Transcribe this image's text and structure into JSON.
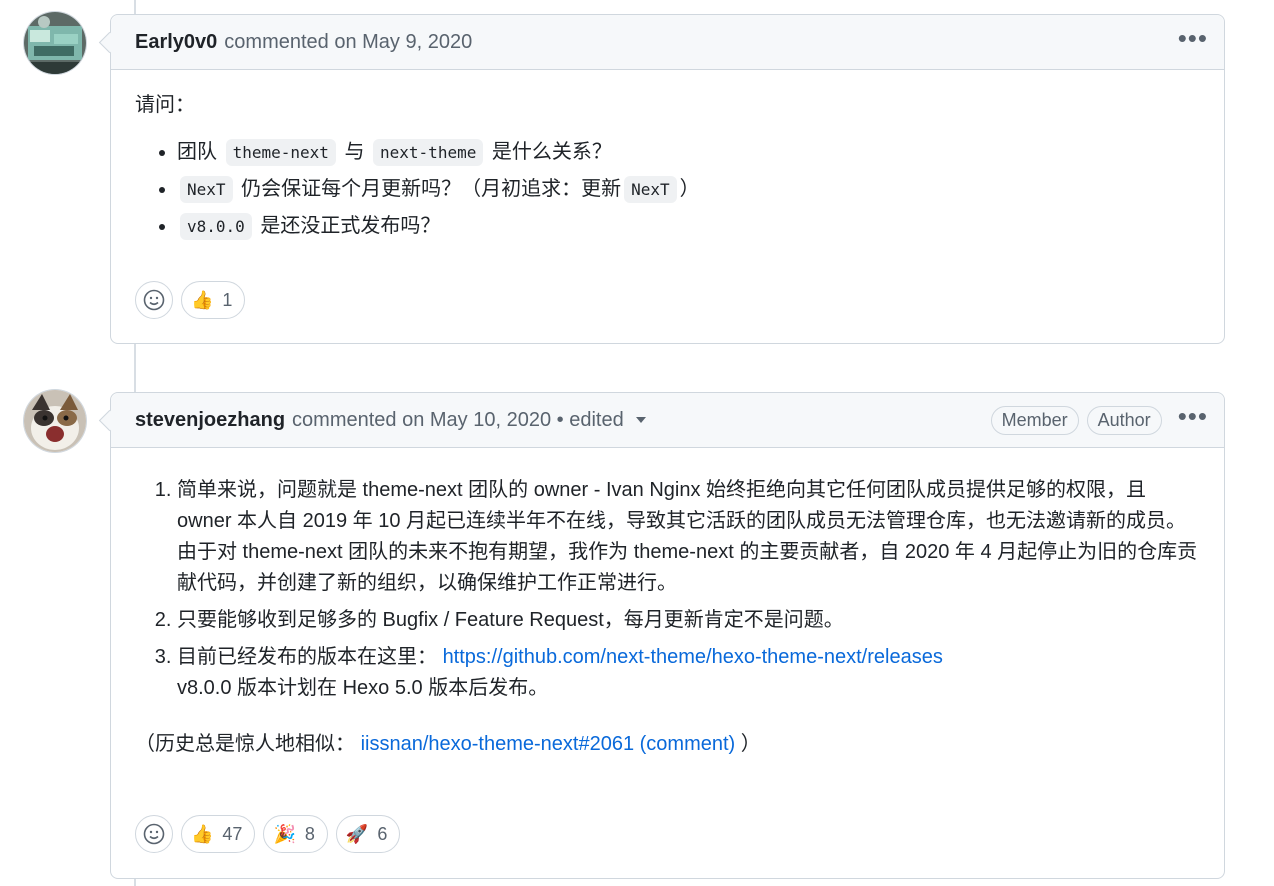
{
  "comments": [
    {
      "author": "Early0v0",
      "meta": "commented on May 9, 2020",
      "menu": "•••",
      "intro": "请问：",
      "bullets": [
        {
          "pre": "团队",
          "code1": "theme-next",
          "mid": "与",
          "code2": "next-theme",
          "post": "是什么关系？"
        },
        {
          "code1": "NexT",
          "mid": "仍会保证每个月更新吗？（月初追求：更新",
          "code2": "NexT",
          "post": "）"
        },
        {
          "code1": "v8.0.0",
          "post": "是还没正式发布吗？"
        }
      ],
      "reactions": [
        {
          "icon": "thumbs-up-icon",
          "count": "1"
        }
      ]
    },
    {
      "author": "stevenjoezhang",
      "meta": "commented on May 10, 2020 • edited",
      "badges": [
        "Member",
        "Author"
      ],
      "menu": "•••",
      "items": [
        {
          "l1": "简单来说，问题就是 theme-next 团队的 owner - Ivan Nginx 始终拒绝向其它任何团队成员提供足够的权限，且 owner 本人自 2019 年 10 月起已连续半年不在线，导致其它活跃的团队成员无法管理仓库，也无法邀请新的成员。",
          "l2": "由于对 theme-next 团队的未来不抱有期望，我作为 theme-next 的主要贡献者，自 2020 年 4 月起停止为旧的仓库贡献代码，并创建了新的组织，以确保维护工作正常进行。"
        },
        {
          "l1": "只要能够收到足够多的 Bugfix / Feature Request，每月更新肯定不是问题。"
        },
        {
          "l1": "目前已经发布的版本在这里：",
          "link": "https://github.com/next-theme/hexo-theme-next/releases",
          "l2": "v8.0.0 版本计划在 Hexo 5.0 版本后发布。"
        }
      ],
      "history_pre": "（历史总是惊人地相似：",
      "history_link": "iissnan/hexo-theme-next#2061 (comment)",
      "history_post": "）",
      "reactions": [
        {
          "icon": "thumbs-up-icon",
          "count": "47"
        },
        {
          "icon": "party-popper-icon",
          "count": "8"
        },
        {
          "icon": "rocket-icon",
          "count": "6"
        }
      ]
    }
  ],
  "colors": {
    "link": "#0969da",
    "border": "#d0d7de",
    "header_bg": "#f6f8fa",
    "muted": "#59636e"
  }
}
